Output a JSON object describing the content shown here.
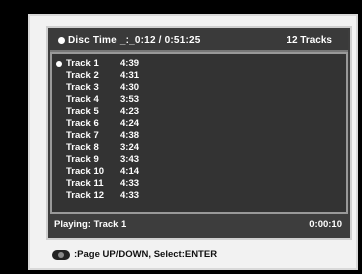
{
  "header": {
    "disc_time": "Disc Time _:_0:12 / 0:51:25",
    "track_count": "12 Tracks"
  },
  "tracks": [
    {
      "name": "Track 1",
      "time": "4:39",
      "selected": true
    },
    {
      "name": "Track 2",
      "time": "4:31"
    },
    {
      "name": "Track 3",
      "time": "4:30"
    },
    {
      "name": "Track 4",
      "time": "3:53"
    },
    {
      "name": "Track 5",
      "time": "4:23"
    },
    {
      "name": "Track 6",
      "time": "4:24"
    },
    {
      "name": "Track 7",
      "time": "4:38"
    },
    {
      "name": "Track 8",
      "time": "3:24"
    },
    {
      "name": "Track 9",
      "time": "3:43"
    },
    {
      "name": "Track 10",
      "time": "4:14"
    },
    {
      "name": "Track 11",
      "time": "4:33"
    },
    {
      "name": "Track 12",
      "time": "4:33"
    }
  ],
  "status": {
    "playing": "Playing: Track 1",
    "elapsed": "0:00:10"
  },
  "hint": {
    "icon": "remote-dpad-icon",
    "text": ":Page UP/DOWN, Select:ENTER"
  },
  "colors": {
    "panel_bg": "#3d3d3d",
    "text": "#ffffff",
    "frame": "#f2f2f2"
  }
}
